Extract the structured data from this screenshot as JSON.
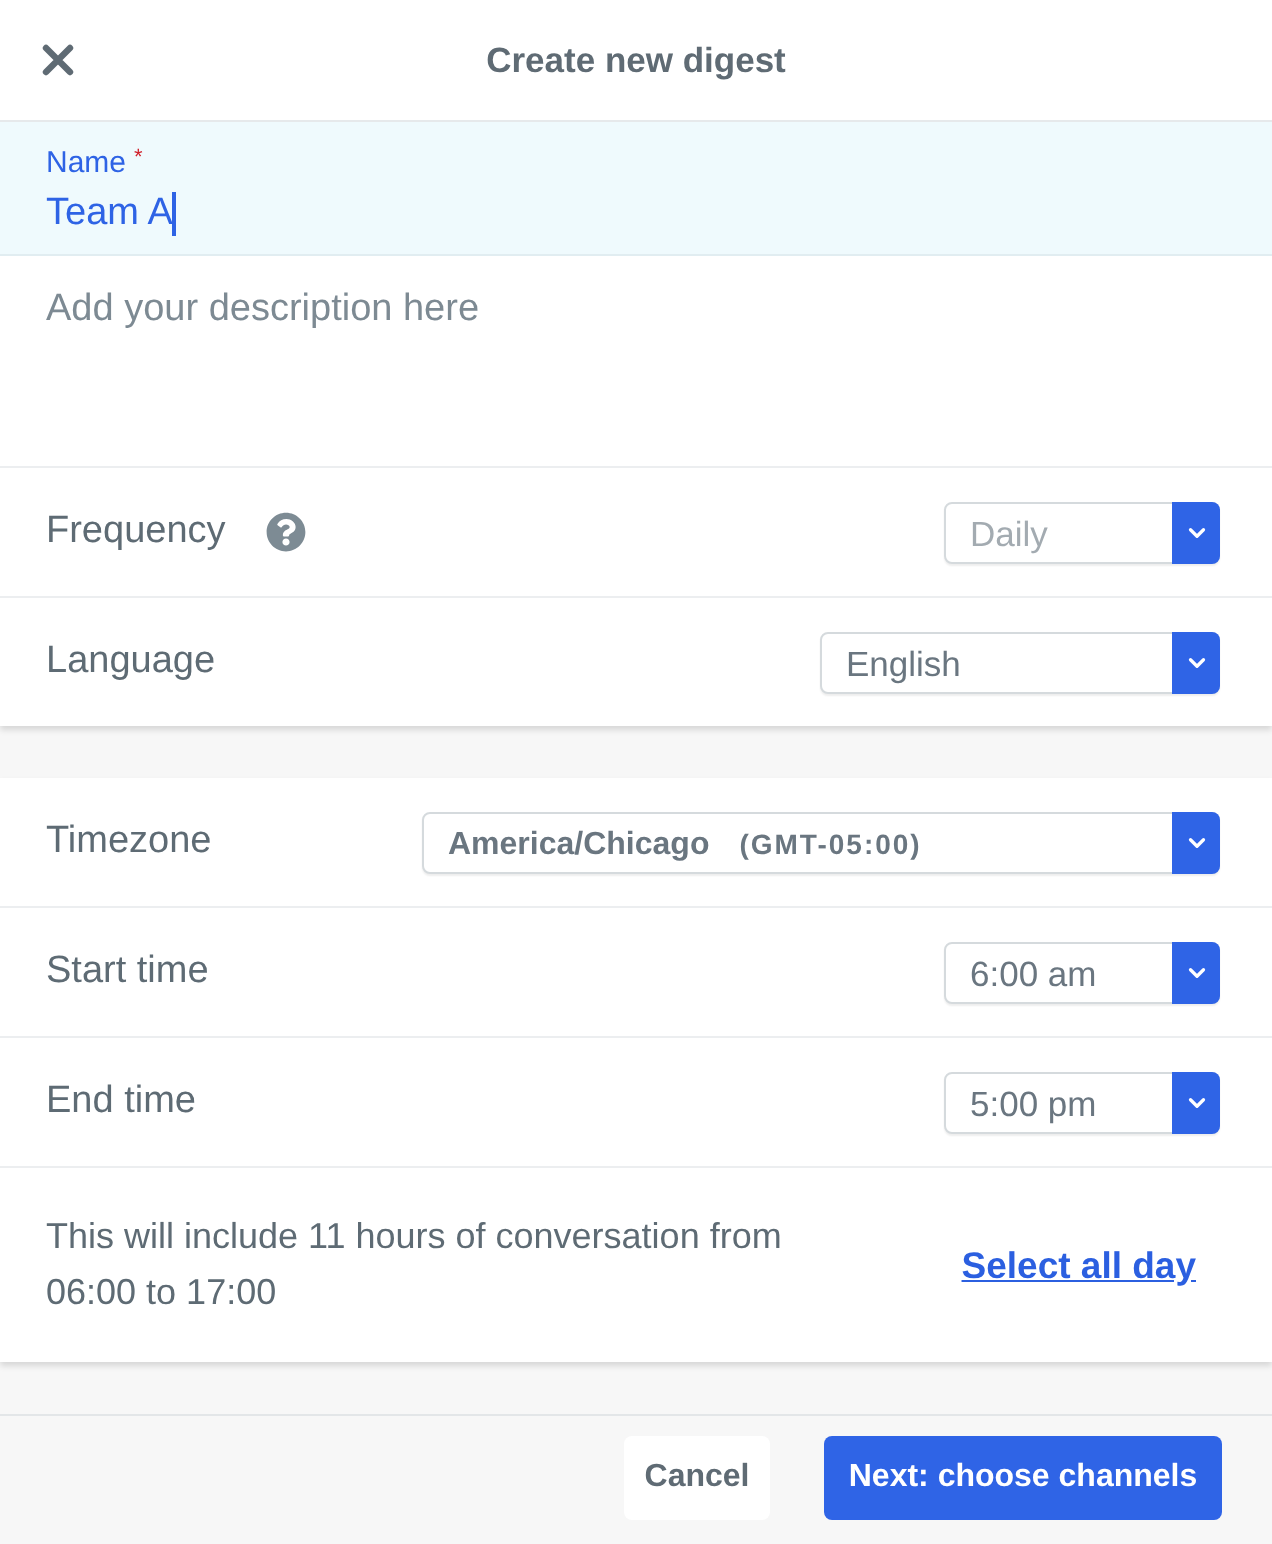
{
  "header": {
    "title": "Create new digest"
  },
  "name_field": {
    "label": "Name",
    "required_mark": "*",
    "value": "Team A",
    "focused": true
  },
  "description_field": {
    "placeholder": "Add your description here"
  },
  "general_settings": [
    {
      "label": "Frequency",
      "help": true,
      "value": "Daily",
      "disabled": true
    },
    {
      "label": "Language",
      "help": false,
      "value": "English",
      "disabled": false
    }
  ],
  "schedule": {
    "rows": [
      {
        "label": "Timezone",
        "value": "America/Chicago",
        "detail": "(GMT-05:00)",
        "disabled": false
      },
      {
        "label": "Start time",
        "value": "6:00 am",
        "disabled": false
      },
      {
        "label": "End time",
        "value": "5:00 pm",
        "disabled": false
      }
    ],
    "summary": "This will include 11 hours of conversation from 06:00 to 17:00",
    "link": "Select all day"
  },
  "buttons": [
    {
      "label": "Cancel",
      "kind": "secondary"
    },
    {
      "label": "Next: choose channels",
      "kind": "primary"
    }
  ]
}
